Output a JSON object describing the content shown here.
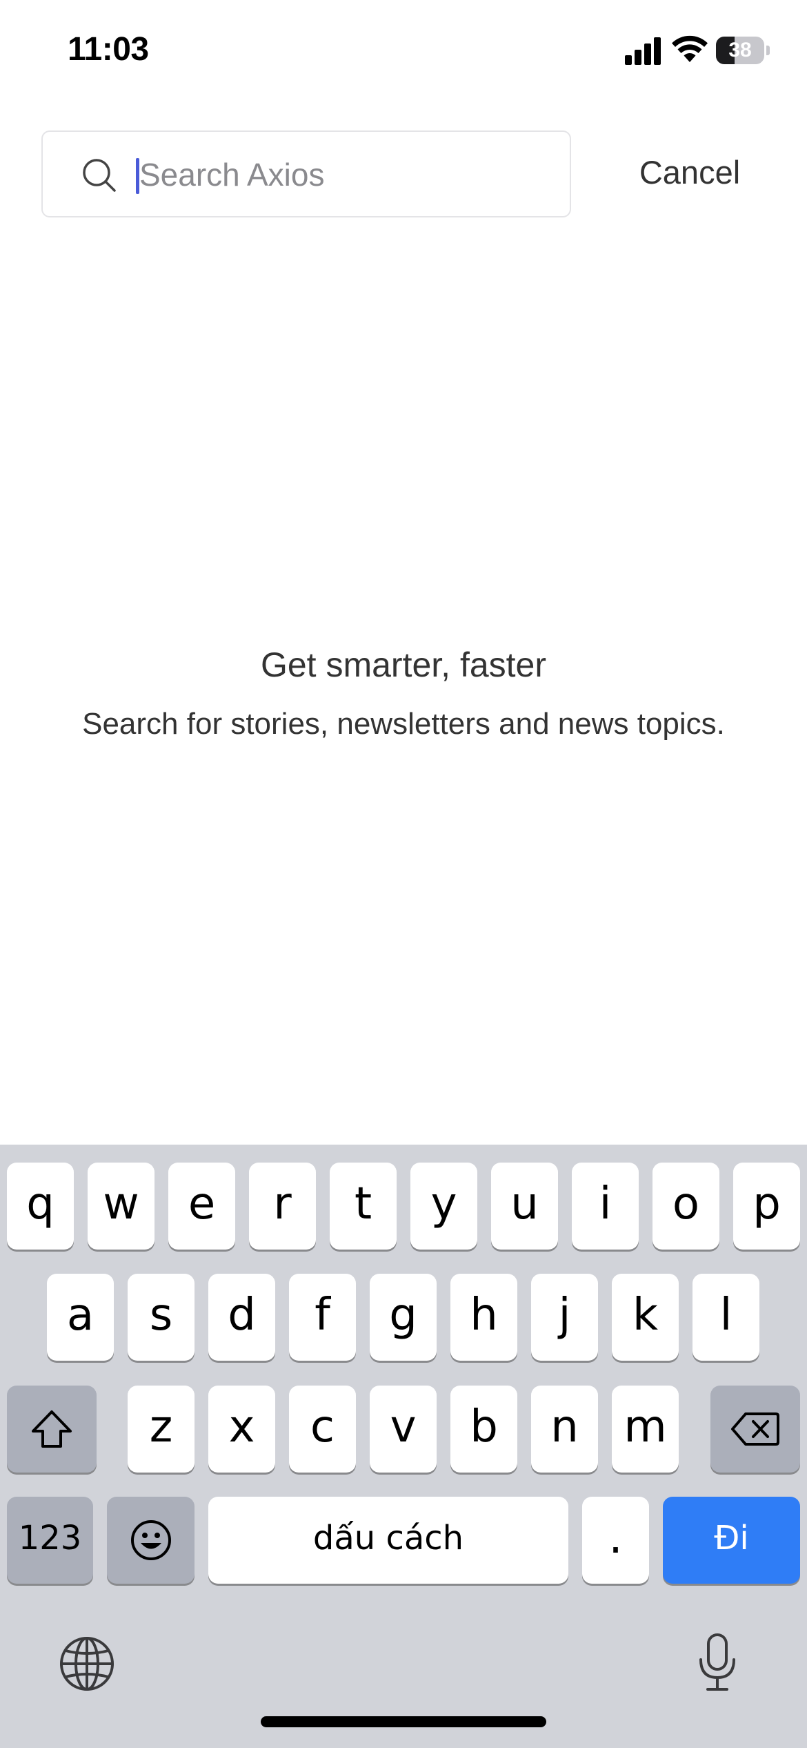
{
  "status_bar": {
    "time": "11:03",
    "battery_level": "38",
    "battery_fraction": 0.38,
    "icons": [
      "signal-icon",
      "wifi-icon",
      "battery-icon"
    ]
  },
  "search": {
    "placeholder": "Search Axios",
    "value": "",
    "cancel_label": "Cancel",
    "caret_color": "#4a5bd8"
  },
  "empty_state": {
    "title": "Get smarter, faster",
    "subtitle": "Search for stories, newsletters and news topics."
  },
  "keyboard": {
    "row1": [
      "q",
      "w",
      "e",
      "r",
      "t",
      "y",
      "u",
      "i",
      "o",
      "p"
    ],
    "row2": [
      "a",
      "s",
      "d",
      "f",
      "g",
      "h",
      "j",
      "k",
      "l"
    ],
    "row3": [
      "z",
      "x",
      "c",
      "v",
      "b",
      "n",
      "m"
    ],
    "numbers_label": "123",
    "space_label": "dấu cách",
    "period_label": ".",
    "go_label": "Đi",
    "go_color": "#2f7df6",
    "icons": [
      "shift-icon",
      "backspace-icon",
      "emoji-icon",
      "globe-icon",
      "microphone-icon"
    ]
  }
}
